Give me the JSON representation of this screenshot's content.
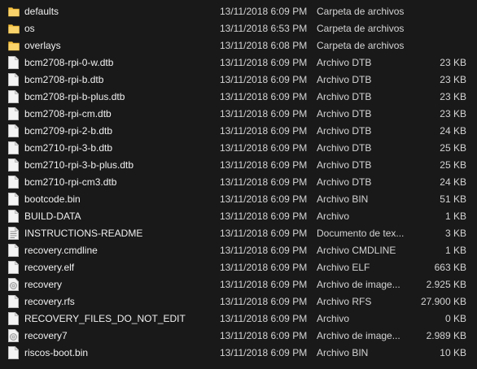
{
  "files": [
    {
      "name": "defaults",
      "date": "13/11/2018 6:09 PM",
      "type": "Carpeta de archivos",
      "size": "",
      "icon": "folder-icon"
    },
    {
      "name": "os",
      "date": "13/11/2018 6:53 PM",
      "type": "Carpeta de archivos",
      "size": "",
      "icon": "folder-icon"
    },
    {
      "name": "overlays",
      "date": "13/11/2018 6:08 PM",
      "type": "Carpeta de archivos",
      "size": "",
      "icon": "folder-icon"
    },
    {
      "name": "bcm2708-rpi-0-w.dtb",
      "date": "13/11/2018 6:09 PM",
      "type": "Archivo DTB",
      "size": "23 KB",
      "icon": "file-icon"
    },
    {
      "name": "bcm2708-rpi-b.dtb",
      "date": "13/11/2018 6:09 PM",
      "type": "Archivo DTB",
      "size": "23 KB",
      "icon": "file-icon"
    },
    {
      "name": "bcm2708-rpi-b-plus.dtb",
      "date": "13/11/2018 6:09 PM",
      "type": "Archivo DTB",
      "size": "23 KB",
      "icon": "file-icon"
    },
    {
      "name": "bcm2708-rpi-cm.dtb",
      "date": "13/11/2018 6:09 PM",
      "type": "Archivo DTB",
      "size": "23 KB",
      "icon": "file-icon"
    },
    {
      "name": "bcm2709-rpi-2-b.dtb",
      "date": "13/11/2018 6:09 PM",
      "type": "Archivo DTB",
      "size": "24 KB",
      "icon": "file-icon"
    },
    {
      "name": "bcm2710-rpi-3-b.dtb",
      "date": "13/11/2018 6:09 PM",
      "type": "Archivo DTB",
      "size": "25 KB",
      "icon": "file-icon"
    },
    {
      "name": "bcm2710-rpi-3-b-plus.dtb",
      "date": "13/11/2018 6:09 PM",
      "type": "Archivo DTB",
      "size": "25 KB",
      "icon": "file-icon"
    },
    {
      "name": "bcm2710-rpi-cm3.dtb",
      "date": "13/11/2018 6:09 PM",
      "type": "Archivo DTB",
      "size": "24 KB",
      "icon": "file-icon"
    },
    {
      "name": "bootcode.bin",
      "date": "13/11/2018 6:09 PM",
      "type": "Archivo BIN",
      "size": "51 KB",
      "icon": "file-icon"
    },
    {
      "name": "BUILD-DATA",
      "date": "13/11/2018 6:09 PM",
      "type": "Archivo",
      "size": "1 KB",
      "icon": "file-icon"
    },
    {
      "name": "INSTRUCTIONS-README",
      "date": "13/11/2018 6:09 PM",
      "type": "Documento de tex...",
      "size": "3 KB",
      "icon": "text-document-icon"
    },
    {
      "name": "recovery.cmdline",
      "date": "13/11/2018 6:09 PM",
      "type": "Archivo CMDLINE",
      "size": "1 KB",
      "icon": "file-icon"
    },
    {
      "name": "recovery.elf",
      "date": "13/11/2018 6:09 PM",
      "type": "Archivo ELF",
      "size": "663 KB",
      "icon": "file-icon"
    },
    {
      "name": "recovery",
      "date": "13/11/2018 6:09 PM",
      "type": "Archivo de image...",
      "size": "2.925 KB",
      "icon": "disc-image-icon"
    },
    {
      "name": "recovery.rfs",
      "date": "13/11/2018 6:09 PM",
      "type": "Archivo RFS",
      "size": "27.900 KB",
      "icon": "file-icon"
    },
    {
      "name": "RECOVERY_FILES_DO_NOT_EDIT",
      "date": "13/11/2018 6:09 PM",
      "type": "Archivo",
      "size": "0 KB",
      "icon": "file-icon"
    },
    {
      "name": "recovery7",
      "date": "13/11/2018 6:09 PM",
      "type": "Archivo de image...",
      "size": "2.989 KB",
      "icon": "disc-image-icon"
    },
    {
      "name": "riscos-boot.bin",
      "date": "13/11/2018 6:09 PM",
      "type": "Archivo BIN",
      "size": "10 KB",
      "icon": "file-icon"
    }
  ],
  "colors": {
    "background": "#191919",
    "folder": "#f6c344",
    "file": "#f2f2f2"
  }
}
